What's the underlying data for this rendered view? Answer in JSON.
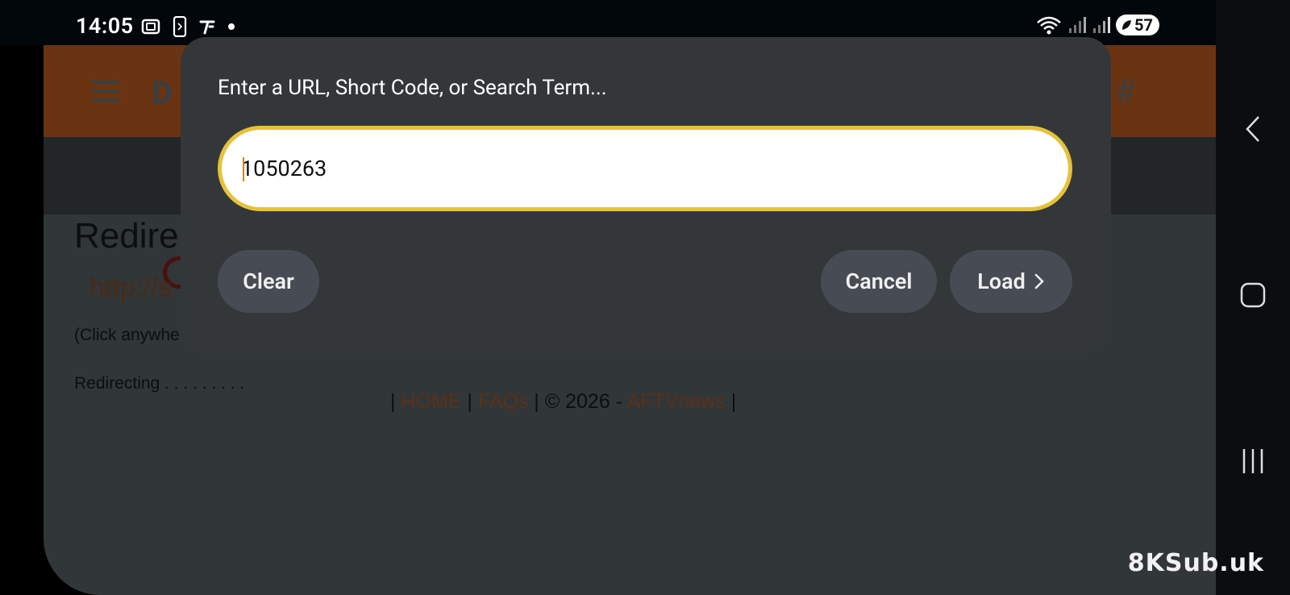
{
  "status_bar": {
    "time": "14:05",
    "battery": "57",
    "left_icons": [
      "screenshot-icon",
      "phone-icon",
      "tv-icon",
      "dot-icon"
    ],
    "right_icons": [
      "wifi-icon",
      "signal-icon",
      "signal-icon"
    ]
  },
  "webpage": {
    "title": "Redire",
    "url": "http://s",
    "click_hint": "(Click anywhe",
    "redirecting": "Redirecting . . . . . . . . .",
    "footer": {
      "sep_start": "| ",
      "home": "HOME",
      "sep1": " | ",
      "faqs": "FAQs",
      "copyright": " | © 2026 - ",
      "brand": "AFTVnews",
      "sep_end": " |"
    },
    "colors": {
      "header": "#6a3412",
      "link": "#5a3116"
    }
  },
  "dialog": {
    "title": "Enter a URL, Short Code, or Search Term...",
    "input_value": "1050263",
    "buttons": {
      "clear": "Clear",
      "cancel": "Cancel",
      "load": "Load"
    },
    "colors": {
      "input_border": "#e6c13a",
      "button_bg": "#474b54",
      "dialog_bg": "#33373a"
    }
  },
  "watermark": "8KSub.uk"
}
